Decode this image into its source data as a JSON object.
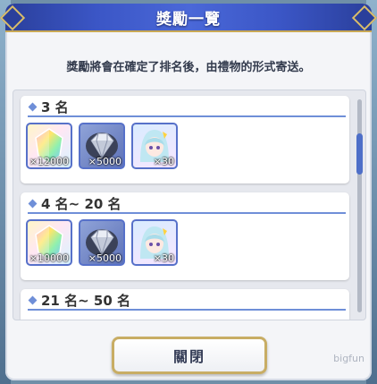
{
  "dialog": {
    "title": "獎勵一覽",
    "notice": "獎勵將會在確定了排名後，由禮物的形式寄送。",
    "close_label": "關閉"
  },
  "tiers": [
    {
      "label": "3 名",
      "items": [
        {
          "icon": "rainbow-jewel-icon",
          "qty": "×12000"
        },
        {
          "icon": "diamond-ore-icon",
          "qty": "×5000"
        },
        {
          "icon": "character-memory-piece-icon",
          "qty": "×30"
        }
      ]
    },
    {
      "label": "4 名~ 20 名",
      "items": [
        {
          "icon": "rainbow-jewel-icon",
          "qty": "×10000"
        },
        {
          "icon": "diamond-ore-icon",
          "qty": "×5000"
        },
        {
          "icon": "character-memory-piece-icon",
          "qty": "×30"
        }
      ]
    },
    {
      "label": "21 名~ 50 名",
      "items": []
    }
  ],
  "watermark": "bigfun",
  "colors": {
    "title_bar": "#3b56c6",
    "accent_line": "#6f8fd8",
    "button_border": "#c8ad64",
    "scroll_thumb": "#4e6fc8"
  }
}
